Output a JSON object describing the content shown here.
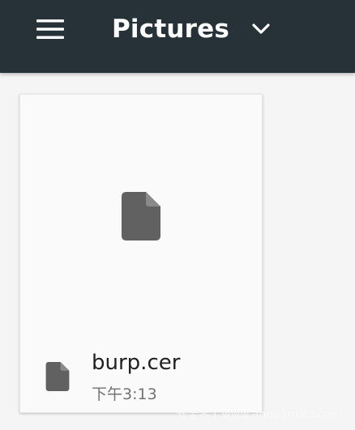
{
  "toolbar": {
    "title": "Pictures",
    "menu_icon": "hamburger-menu-icon",
    "dropdown_icon": "chevron-down-icon",
    "background": "#263238"
  },
  "files": [
    {
      "name": "burp.cer",
      "time": "下午3:13",
      "icon": "file-icon"
    }
  ],
  "watermark": "安全客 ( www.anquanke.com )"
}
